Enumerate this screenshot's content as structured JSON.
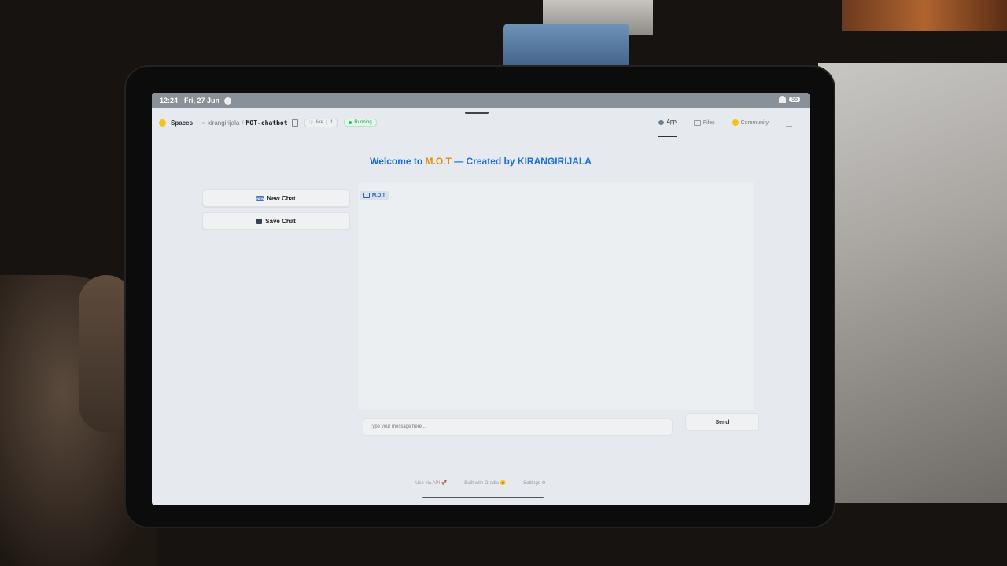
{
  "status_bar": {
    "time": "12:24",
    "date": "Fri, 27 Jun",
    "battery": "55"
  },
  "header": {
    "spaces_label": "Spaces",
    "owner": "kirangirijala",
    "slash": "/",
    "repo_name": "MOT-chatbot",
    "like_label": "like",
    "like_count": "1",
    "status": "Running",
    "tabs": [
      {
        "label": "App",
        "icon": "app-icon",
        "active": true
      },
      {
        "label": "Files",
        "icon": "files-icon",
        "active": false
      },
      {
        "label": "Community",
        "icon": "community-icon",
        "active": false
      }
    ]
  },
  "app": {
    "title_prefix": "Welcome to ",
    "title_accent": "M.O.T",
    "title_suffix": " — Created by KIRANGIRIJALA",
    "new_chat_label": "New Chat",
    "save_chat_label": "Save Chat",
    "chatbot_label": "M.O.T",
    "input_placeholder": "Type your message here...",
    "send_label": "Send"
  },
  "footer": {
    "api": "Use via API",
    "gradio": "Built with Gradio",
    "settings": "Settings"
  },
  "colors": {
    "title": "#1f6fd6",
    "accent": "#e08b14",
    "running": "#1f9d55"
  }
}
